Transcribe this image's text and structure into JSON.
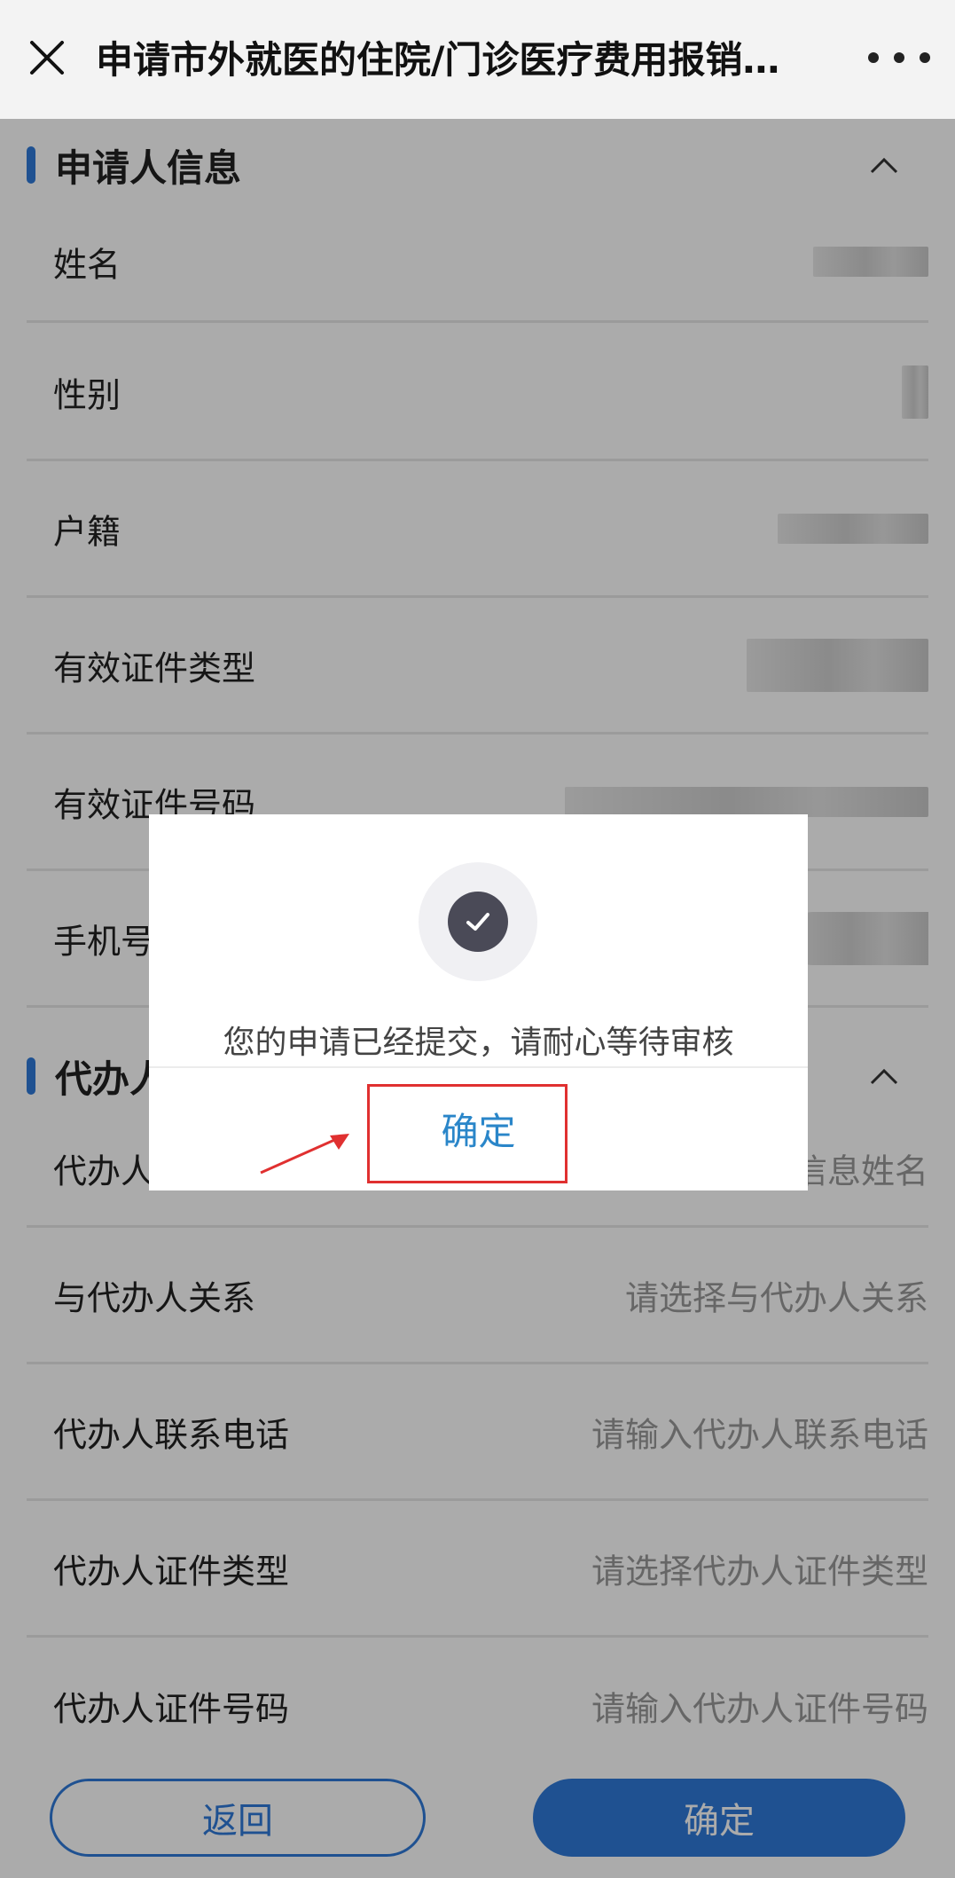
{
  "nav": {
    "title": "申请市外就医的住院/门诊医疗费用报销…"
  },
  "sections": {
    "applicant": {
      "title": "申请人信息",
      "rows": [
        {
          "label": "姓名"
        },
        {
          "label": "性别"
        },
        {
          "label": "户籍"
        },
        {
          "label": "有效证件类型"
        },
        {
          "label": "有效证件号码"
        },
        {
          "label": "手机号"
        }
      ]
    },
    "agent": {
      "title": "代办人",
      "rows": [
        {
          "label": "代办人",
          "placeholder": "信息姓名"
        },
        {
          "label": "与代办人关系",
          "placeholder": "请选择与代办人关系"
        },
        {
          "label": "代办人联系电话",
          "placeholder": "请输入代办人联系电话"
        },
        {
          "label": "代办人证件类型",
          "placeholder": "请选择代办人证件类型"
        },
        {
          "label": "代办人证件号码",
          "placeholder": "请输入代办人证件号码"
        }
      ]
    }
  },
  "footer": {
    "back_label": "返回",
    "confirm_label": "确定"
  },
  "modal": {
    "message": "您的申请已经提交，请耐心等待审核",
    "ok_label": "确定"
  },
  "colors": {
    "accent": "#2f7ad9",
    "ok_text": "#2a86c9",
    "highlight": "#e03030"
  }
}
